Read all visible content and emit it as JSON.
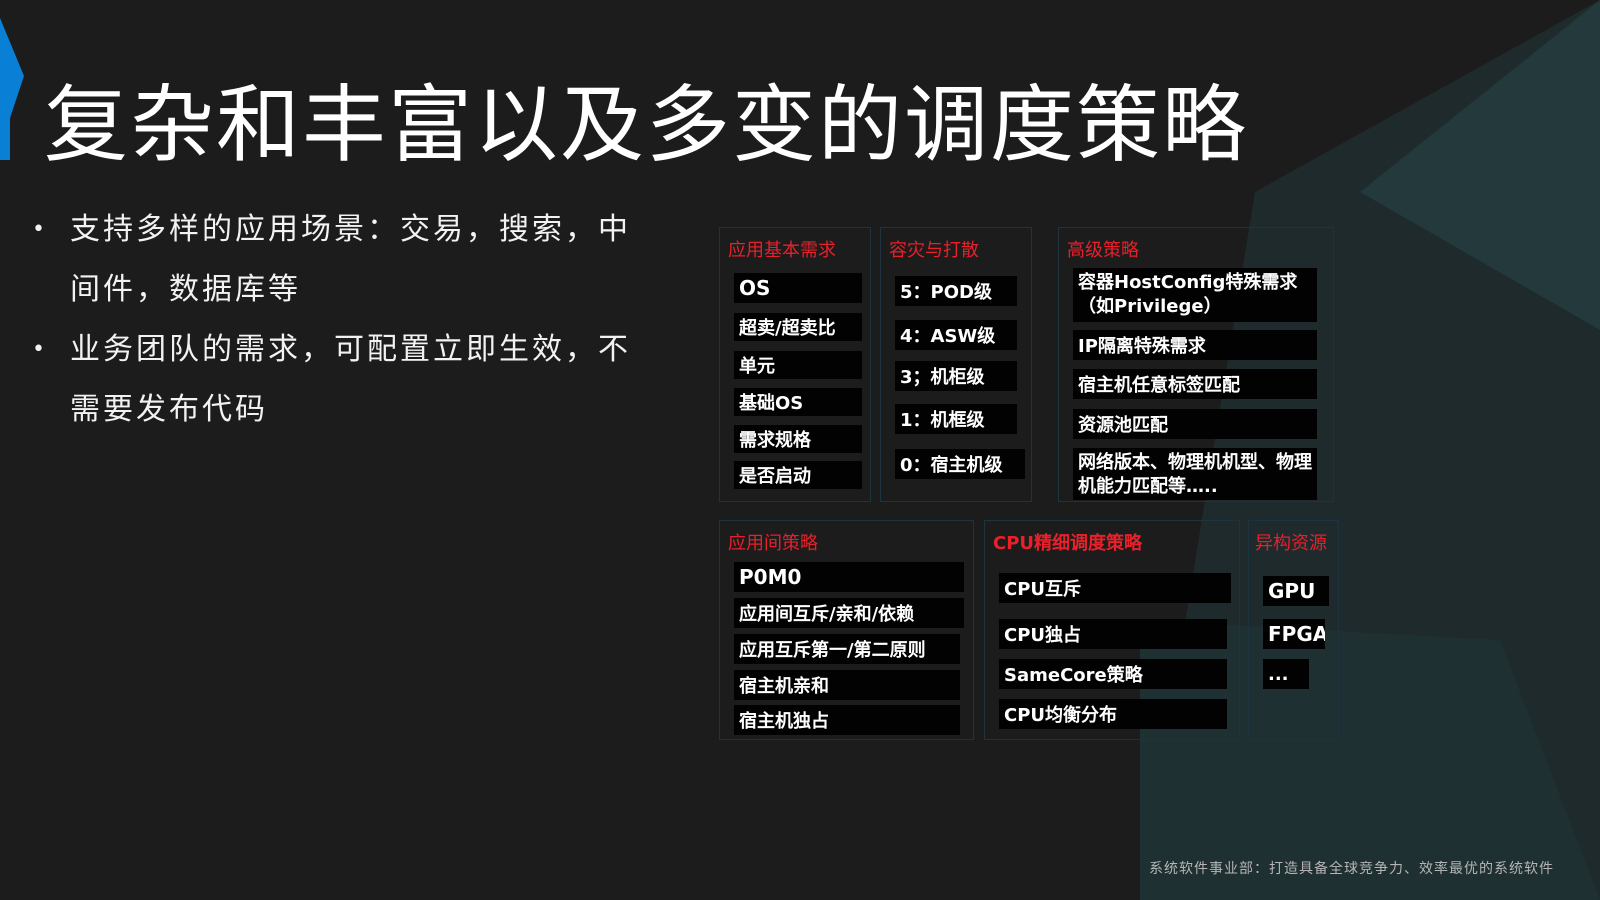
{
  "colors": {
    "accent": "#0a7fd6",
    "heading_red": "#e8202a",
    "background": "#1c1c1c"
  },
  "slide": {
    "title": "复杂和丰富以及多变的调度策略"
  },
  "bullets": [
    "支持多样的应用场景：交易，搜索，中间件，数据库等",
    "业务团队的需求，可配置立即生效，不需要发布代码"
  ],
  "panels": {
    "basic": {
      "title": "应用基本需求",
      "items": [
        "OS",
        "超卖/超卖比",
        "单元",
        "基础OS",
        "需求规格",
        "是否启动"
      ]
    },
    "disaster": {
      "title": "容灾与打散",
      "items": [
        "5：POD级",
        "4：ASW级",
        "3；机柜级",
        "1：机框级",
        "0：宿主机级"
      ]
    },
    "advanced": {
      "title": "高级策略",
      "items": [
        "容器HostConfig特殊需求（如Privilege）",
        "IP隔离特殊需求",
        "宿主机任意标签匹配",
        "资源池匹配",
        "网络版本、物理机机型、物理机能力匹配等….."
      ]
    },
    "inter_app": {
      "title": "应用间策略",
      "items": [
        "P0M0",
        "应用间互斥/亲和/依赖",
        "应用互斥第一/第二原则",
        "宿主机亲和",
        "宿主机独占"
      ]
    },
    "cpu": {
      "title": "CPU精细调度策略",
      "items": [
        "CPU互斥",
        "CPU独占",
        "SameCore策略",
        "CPU均衡分布"
      ]
    },
    "hetero": {
      "title": "异构资源",
      "items": [
        "GPU",
        "FPGA",
        "..."
      ]
    }
  },
  "footer": {
    "text": "系统软件事业部：打造具备全球竞争力、效率最优的系统软件"
  }
}
